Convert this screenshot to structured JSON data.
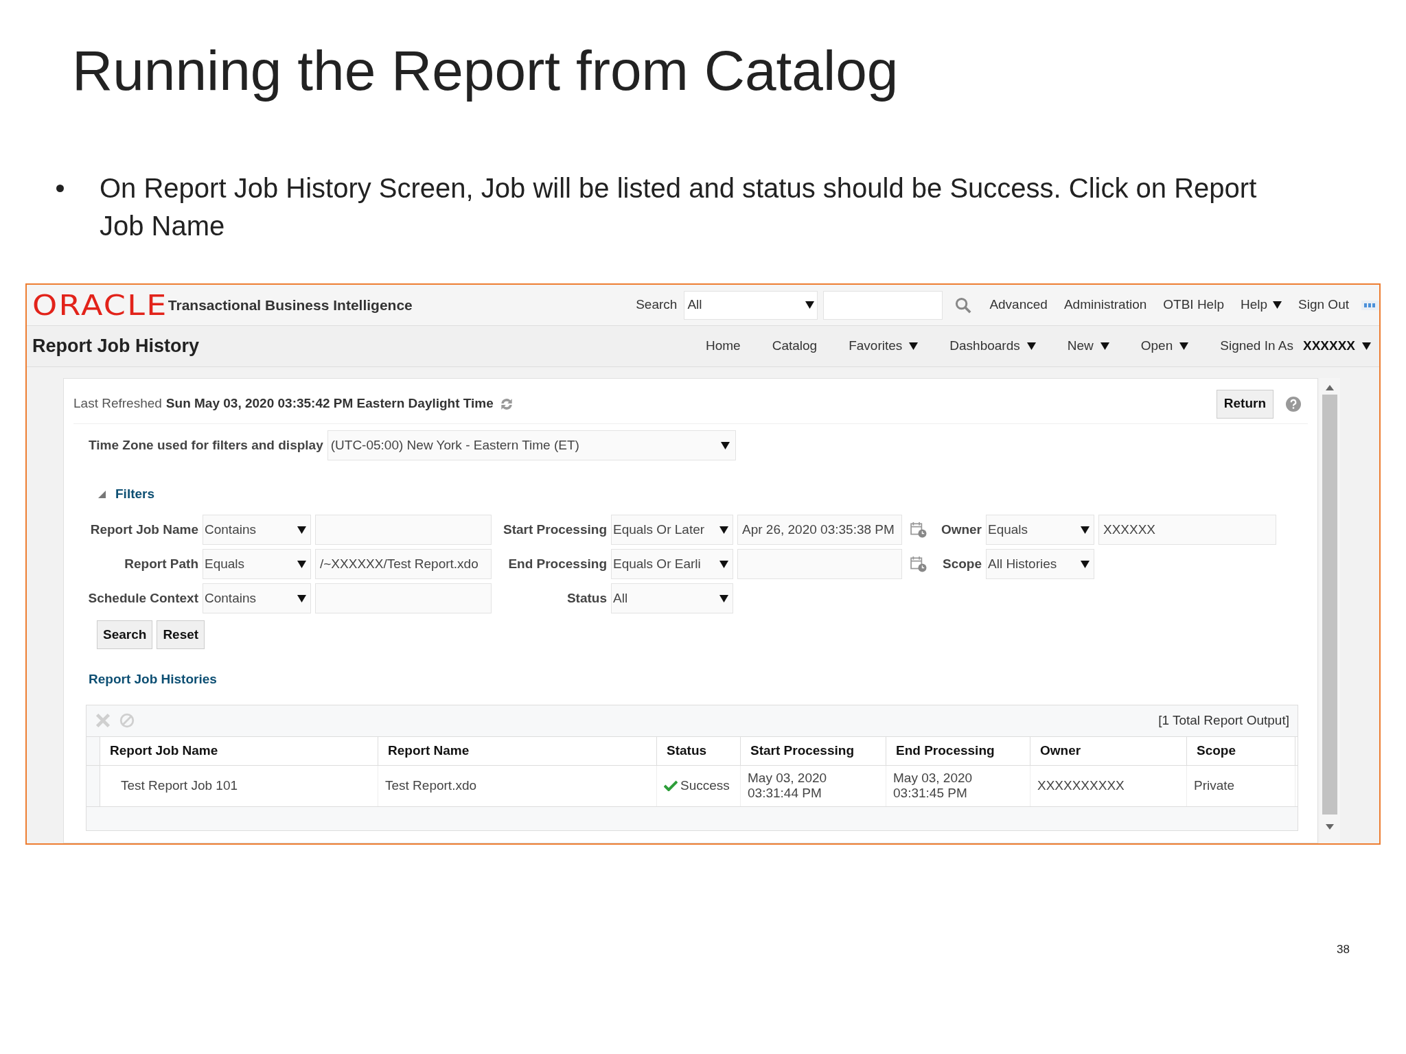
{
  "slide": {
    "title": "Running the Report from Catalog",
    "bullets": [
      "On Report Job History Screen, Job will be listed and status should be Success. Click on Report Job Name"
    ],
    "page_number": "38"
  },
  "app": {
    "brand": {
      "logo": "ORACLE",
      "product": "Transactional Business Intelligence"
    },
    "global_search": {
      "label": "Search",
      "scope": "All"
    },
    "global_links": [
      {
        "label": "Advanced",
        "dropdown": false
      },
      {
        "label": "Administration",
        "dropdown": false
      },
      {
        "label": "OTBI Help",
        "dropdown": false
      },
      {
        "label": "Help",
        "dropdown": true
      },
      {
        "label": "Sign Out",
        "dropdown": false
      }
    ],
    "page_title": "Report Job History",
    "nav": [
      {
        "label": "Home",
        "dropdown": false
      },
      {
        "label": "Catalog",
        "dropdown": false
      },
      {
        "label": "Favorites",
        "dropdown": true
      },
      {
        "label": "Dashboards",
        "dropdown": true
      },
      {
        "label": "New",
        "dropdown": true
      },
      {
        "label": "Open",
        "dropdown": true
      }
    ],
    "signed_in": {
      "label": "Signed In As",
      "user": "XXXXXX"
    },
    "last_refreshed": {
      "label": "Last Refreshed",
      "value": "Sun May 03, 2020 03:35:42 PM Eastern Daylight Time"
    },
    "return_button": "Return",
    "time_zone": {
      "label": "Time Zone used for filters and display",
      "value": "(UTC-05:00) New York - Eastern Time (ET)"
    },
    "filters": {
      "title": "Filters",
      "expanded": true,
      "rows": [
        [
          {
            "kind": "text",
            "label": "Report Job Name",
            "operator": "Contains"
          },
          {
            "kind": "date",
            "label": "Start Processing",
            "operator": "Equals Or Later",
            "value": "Apr 26, 2020 03:35:38 PM"
          },
          {
            "kind": "text",
            "label": "Owner",
            "operator": "Equals",
            "value": "XXXXXX"
          }
        ],
        [
          {
            "kind": "text",
            "label": "Report Path",
            "operator": "Equals",
            "value": "/~XXXXXX/Test Report.xdo"
          },
          {
            "kind": "date",
            "label": "End Processing",
            "operator": "Equals Or Earli"
          },
          {
            "kind": "select",
            "label": "Scope",
            "operator": "All Histories"
          }
        ],
        [
          {
            "kind": "text",
            "label": "Schedule Context",
            "operator": "Contains"
          },
          {
            "kind": "select",
            "label": "Status",
            "operator": "All"
          }
        ]
      ]
    },
    "buttons": [
      "Search",
      "Reset"
    ],
    "histories": {
      "title": "Report Job Histories",
      "toolbar": [
        {
          "kind": "delete",
          "disabled": true
        },
        {
          "kind": "cancel",
          "disabled": true
        }
      ],
      "total": "[1 Total Report Output]",
      "columns": [
        "Report Job Name",
        "Report Name",
        "Status",
        "Start Processing",
        "End Processing",
        "Owner",
        "Scope"
      ],
      "rows": [
        {
          "kind": "success",
          "cells": [
            [
              "Test Report Job 101"
            ],
            [
              "Test Report.xdo"
            ],
            [
              "Success"
            ],
            [
              "May 03, 2020",
              "03:31:44 PM"
            ],
            [
              "May 03, 2020",
              "03:31:45 PM"
            ],
            [
              "XXXXXXXXXX"
            ],
            [
              "Private"
            ]
          ]
        }
      ]
    }
  }
}
